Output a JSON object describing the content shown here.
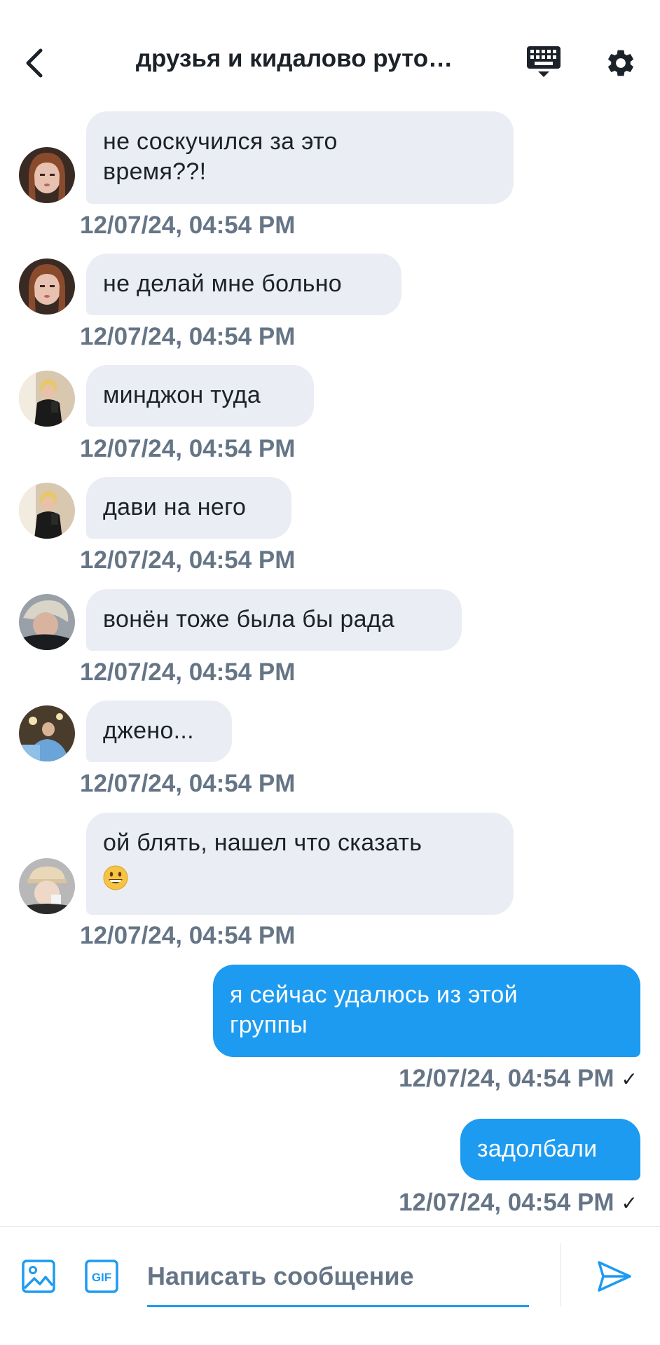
{
  "header": {
    "title": "друзья и кидалово руто…",
    "back_icon": "chevron-left-icon",
    "keyboard_icon": "keyboard-icon",
    "settings_icon": "gear-icon"
  },
  "messages": [
    {
      "direction": "in",
      "avatar": "avatar-girl-1",
      "text": "не соскучился за это\nвремя??!",
      "time": "12/07/24, 04:54 PM"
    },
    {
      "direction": "in",
      "avatar": "avatar-girl-1",
      "text": "не делай мне больно",
      "time": "12/07/24, 04:54 PM"
    },
    {
      "direction": "in",
      "avatar": "avatar-boy-mirror",
      "text": "минджон туда",
      "time": "12/07/24, 04:54 PM"
    },
    {
      "direction": "in",
      "avatar": "avatar-boy-mirror",
      "text": "дави на него",
      "time": "12/07/24, 04:54 PM"
    },
    {
      "direction": "in",
      "avatar": "avatar-blonde",
      "text": "вонён тоже была бы рада",
      "time": "12/07/24, 04:54 PM"
    },
    {
      "direction": "in",
      "avatar": "avatar-room",
      "text": "джено...",
      "time": "12/07/24, 04:54 PM"
    },
    {
      "direction": "in",
      "avatar": "avatar-cap",
      "text": "ой блять, нашел что сказать",
      "emoji": "grinning-face-emoji",
      "time": "12/07/24, 04:54 PM"
    },
    {
      "direction": "out",
      "text": "я сейчас удалюсь из этой\nгруппы",
      "time": "12/07/24, 04:54 PM",
      "status": "✓"
    },
    {
      "direction": "out",
      "text": "задолбали",
      "time": "12/07/24, 04:54 PM",
      "status": "✓"
    }
  ],
  "compose": {
    "placeholder": "Написать сообщение",
    "value": "",
    "media_icon": "image-icon",
    "gif_label": "GIF",
    "send_icon": "send-icon"
  },
  "colors": {
    "accent": "#1d9bf0",
    "bubble_in": "#eaedf3",
    "timestamp": "#657586",
    "text": "#1c2229"
  }
}
